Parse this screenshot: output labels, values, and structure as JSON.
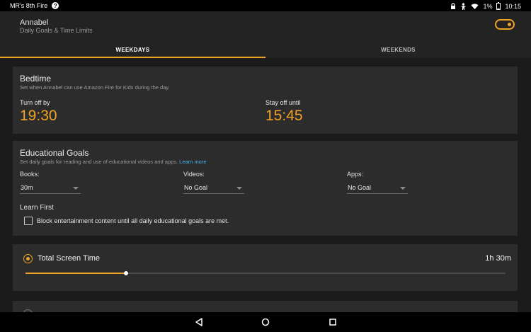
{
  "status_bar": {
    "device_name": "MR's 8th Fire",
    "help_badge": "?",
    "battery": "1%",
    "time": "10:15",
    "icons": [
      "lock-icon",
      "person-icon",
      "wifi-icon",
      "battery-icon"
    ]
  },
  "header": {
    "child_name": "Annabel",
    "subtitle": "Daily Goals & Time Limits",
    "toggle_on": true
  },
  "tabs": [
    {
      "label": "WEEKDAYS",
      "active": true
    },
    {
      "label": "WEEKENDS",
      "active": false
    }
  ],
  "bedtime": {
    "title": "Bedtime",
    "description": "Set when Annabel can use Amazon Fire for Kids during the day.",
    "turn_off_label": "Turn off by",
    "turn_off_value": "19:30",
    "stay_off_label": "Stay off until",
    "stay_off_value": "15:45"
  },
  "educational_goals": {
    "title": "Educational Goals",
    "description": "Set daily goals for reading and use of educational videos and apps.",
    "learn_more": "Learn more",
    "goals": [
      {
        "label": "Books:",
        "value": "30m"
      },
      {
        "label": "Videos:",
        "value": "No Goal"
      },
      {
        "label": "Apps:",
        "value": "No Goal"
      }
    ],
    "learn_first_title": "Learn First",
    "learn_first_checkbox": "Block entertainment content until all daily educational goals are met.",
    "learn_first_checked": false
  },
  "screen_time": {
    "title": "Total Screen Time",
    "value": "1h 30m",
    "slider_fraction": 0.21,
    "selected": true
  },
  "colors": {
    "accent": "#f0a326",
    "link": "#4ab3e8",
    "card": "#2c2c2c",
    "background": "#1b1b1b"
  },
  "nav": [
    "back-icon",
    "home-icon",
    "recents-icon"
  ]
}
